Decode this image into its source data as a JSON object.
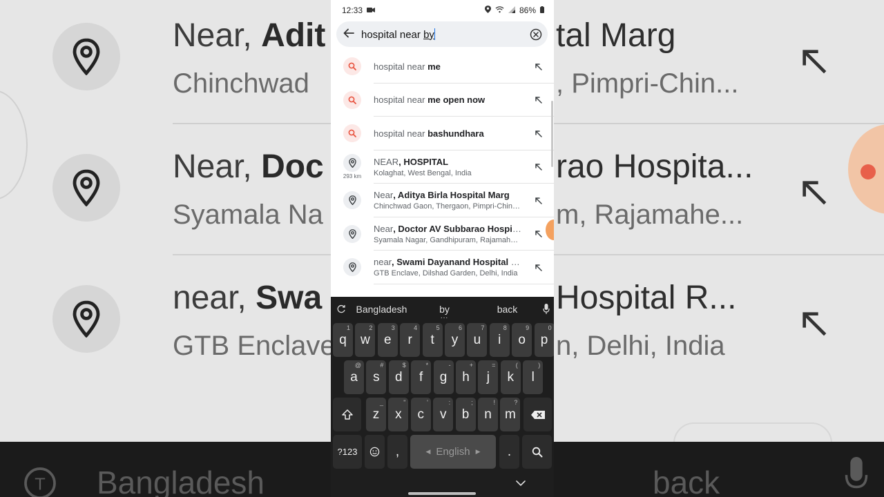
{
  "status": {
    "time": "12:33",
    "battery": "86%"
  },
  "search": {
    "query_prefix": "hospital near ",
    "query_underlined": "by"
  },
  "suggestions": [
    {
      "type": "query",
      "prefix": "hospital near ",
      "bold": "me"
    },
    {
      "type": "query",
      "prefix": "hospital near ",
      "bold": "me open now"
    },
    {
      "type": "query",
      "prefix": "hospital near ",
      "bold": "bashundhara"
    },
    {
      "type": "place",
      "prefix": "NEAR",
      "bold": ", HOSPITAL",
      "address": "Kolaghat, West Bengal, India",
      "distance": "293 km"
    },
    {
      "type": "place",
      "prefix": "Near",
      "bold": ", Aditya Birla Hospital Marg",
      "address": "Chinchwad Gaon, Thergaon, Pimpri-Chinchwad"
    },
    {
      "type": "place",
      "prefix": "Near",
      "bold": ", Doctor AV Subbarao Hospital Road",
      "address": "Syamala Nagar, Gandhipuram, Rajamahendravaram"
    },
    {
      "type": "place",
      "prefix": "near",
      "bold": ", Swami Dayanand Hospital Road",
      "address": "GTB Enclave, Dilshad Garden, Delhi, India"
    }
  ],
  "background": {
    "rows": [
      {
        "prefix": "Near, ",
        "bold": "Adit",
        "right_title": "tal Marg",
        "sub": "Chinchwad",
        "right_sub": ", Pimpri-Chin..."
      },
      {
        "prefix": "Near, ",
        "bold": "Doc",
        "right_title": "rao Hospita...",
        "sub": "Syamala Na",
        "right_sub": "m, Rajamahe..."
      },
      {
        "prefix": "near, ",
        "bold": "Swa",
        "right_title": "Hospital R...",
        "sub": "GTB Enclave",
        "right_sub": "n, Delhi, India"
      }
    ],
    "kb_left": "Bangladesh",
    "kb_right": "back"
  },
  "keyboard": {
    "suggestions": [
      "Bangladesh",
      "by",
      "back"
    ],
    "row1": [
      {
        "k": "q",
        "h": "1"
      },
      {
        "k": "w",
        "h": "2"
      },
      {
        "k": "e",
        "h": "3"
      },
      {
        "k": "r",
        "h": "4"
      },
      {
        "k": "t",
        "h": "5"
      },
      {
        "k": "y",
        "h": "6"
      },
      {
        "k": "u",
        "h": "7"
      },
      {
        "k": "i",
        "h": "8"
      },
      {
        "k": "o",
        "h": "9"
      },
      {
        "k": "p",
        "h": "0"
      }
    ],
    "row2": [
      {
        "k": "a",
        "h": "@"
      },
      {
        "k": "s",
        "h": "#"
      },
      {
        "k": "d",
        "h": "$"
      },
      {
        "k": "f",
        "h": "*"
      },
      {
        "k": "g",
        "h": "-"
      },
      {
        "k": "h",
        "h": "+"
      },
      {
        "k": "j",
        "h": "="
      },
      {
        "k": "k",
        "h": "("
      },
      {
        "k": "l",
        "h": ")"
      }
    ],
    "row3": [
      {
        "k": "z",
        "h": "_"
      },
      {
        "k": "x",
        "h": "\""
      },
      {
        "k": "c",
        "h": "'"
      },
      {
        "k": "v",
        "h": ":"
      },
      {
        "k": "b",
        "h": ";"
      },
      {
        "k": "n",
        "h": "!"
      },
      {
        "k": "m",
        "h": "?"
      }
    ],
    "symbols_label": "?123",
    "comma": ",",
    "space_label": "English",
    "period": "."
  }
}
